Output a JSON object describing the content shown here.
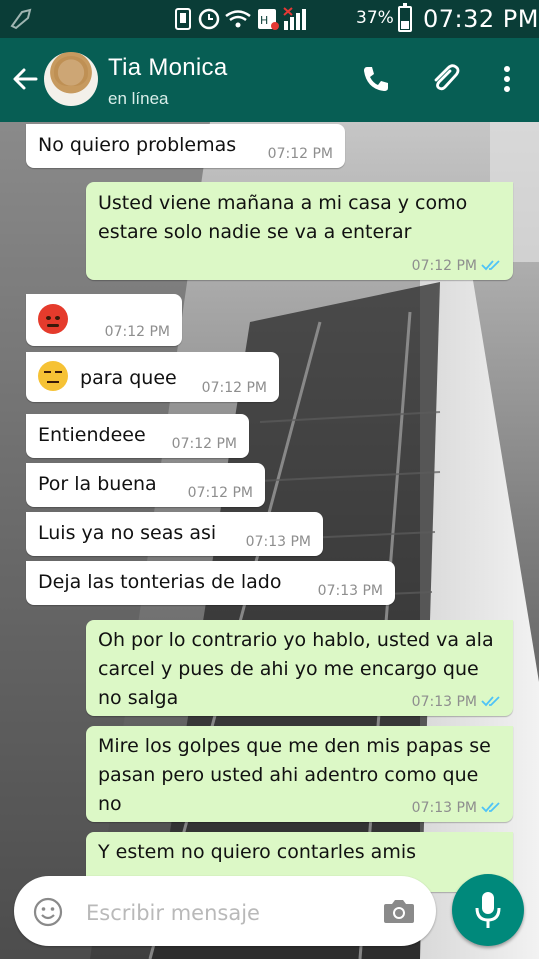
{
  "status_bar": {
    "battery": "37%",
    "time": "07:32 PM"
  },
  "header": {
    "contact_name": "Tia Monica",
    "status": "en línea"
  },
  "messages": [
    {
      "dir": "in",
      "text": "No quiero problemas",
      "time": "07:12 PM"
    },
    {
      "dir": "out",
      "text": "Usted viene mañana a mi casa y como estare solo nadie se va a enterar",
      "time": "07:12 PM"
    },
    {
      "dir": "in",
      "emoji": "angry-face",
      "text": "",
      "time": "07:12 PM"
    },
    {
      "dir": "in",
      "emoji": "unamused-face",
      "text": "para quee",
      "time": "07:12 PM"
    },
    {
      "dir": "in",
      "text": "Entiendeee",
      "time": "07:12 PM"
    },
    {
      "dir": "in",
      "text": "Por la buena",
      "time": "07:12 PM"
    },
    {
      "dir": "in",
      "text": "Luis ya no seas asi",
      "time": "07:13 PM"
    },
    {
      "dir": "in",
      "text": "Deja las tonterias de lado",
      "time": "07:13 PM"
    },
    {
      "dir": "out",
      "text": "Oh por lo contrario yo hablo, usted va ala carcel y pues de ahi yo me encargo que no salga",
      "time": "07:13 PM"
    },
    {
      "dir": "out",
      "text": "Mire los golpes que me den mis papas se pasan pero usted ahi adentro como que no",
      "time": "07:13 PM"
    },
    {
      "dir": "out",
      "text": "Y estem no quiero contarles amis",
      "time": ""
    }
  ],
  "input": {
    "placeholder": "Escribir mensaje"
  },
  "colors": {
    "header": "#075e54",
    "status_bar": "#0a3d37",
    "outgoing_bubble": "#dcf8c6",
    "incoming_bubble": "#ffffff",
    "read_tick": "#4fc3f7",
    "mic_button": "#00897b"
  },
  "icons": [
    "back-arrow-icon",
    "call-icon",
    "attach-icon",
    "menu-icon",
    "smiley-icon",
    "camera-icon",
    "mic-icon"
  ]
}
